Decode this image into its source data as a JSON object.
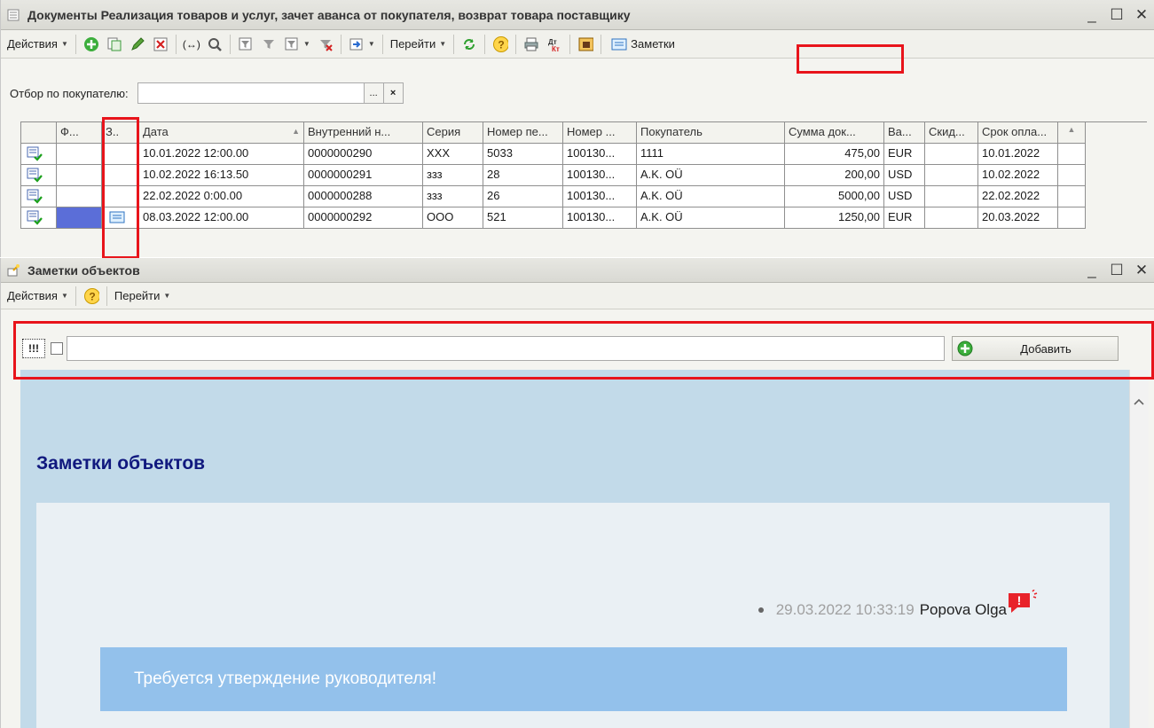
{
  "win1": {
    "title": "Документы Реализация товаров и услуг, зачет аванса от покупателя, возврат товара поставщику",
    "toolbar": {
      "actions": "Действия",
      "goto": "Перейти",
      "notes": "Заметки"
    },
    "filter": {
      "label": "Отбор по покупателю:",
      "value": "",
      "ellipsis": "...",
      "clear": "×"
    },
    "grid": {
      "columns": [
        "Ф...",
        "З..",
        "Дата",
        "Внутренний н...",
        "Серия",
        "Номер пе...",
        "Номер ...",
        "Покупатель",
        "Сумма док...",
        "Ва...",
        "Скид...",
        "Срок опла..."
      ],
      "rows": [
        {
          "date": "10.01.2022 12:00.00",
          "internal": "0000000290",
          "series": "XXX",
          "num1": "5033",
          "num2": "100130...",
          "buyer": "1111",
          "sum": "475,00",
          "cur": "EUR",
          "disc": "",
          "due": "10.01.2022"
        },
        {
          "date": "10.02.2022 16:13.50",
          "internal": "0000000291",
          "series": "ззз",
          "num1": "28",
          "num2": "100130...",
          "buyer": "A.K. OÜ",
          "sum": "200,00",
          "cur": "USD",
          "disc": "",
          "due": "10.02.2022"
        },
        {
          "date": "22.02.2022 0:00.00",
          "internal": "0000000288",
          "series": "ззз",
          "num1": "26",
          "num2": "100130...",
          "buyer": "A.K. OÜ",
          "sum": "5000,00",
          "cur": "USD",
          "disc": "",
          "due": "22.02.2022"
        },
        {
          "date": "08.03.2022 12:00.00",
          "internal": "0000000292",
          "series": "OOO",
          "num1": "521",
          "num2": "100130...",
          "buyer": "A.K. OÜ",
          "sum": "1250,00",
          "cur": "EUR",
          "disc": "",
          "due": "20.03.2022"
        }
      ]
    }
  },
  "win2": {
    "title": "Заметки объектов",
    "toolbar": {
      "actions": "Действия",
      "goto": "Перейти"
    },
    "notebar": {
      "priority_label": "!!!",
      "input_value": "",
      "add_label": "Добавить"
    },
    "content": {
      "heading": "Заметки объектов",
      "note_date": "29.03.2022 10:33:19",
      "note_author": "Popova Olga",
      "note_text": "Требуется утверждение руководителя!"
    }
  },
  "colors": {
    "highlight": "#e8141b",
    "content_bg": "#c2dae9",
    "note_bg": "#93c1eb",
    "heading": "#10187e",
    "selected_cell": "#5b6ed8"
  }
}
